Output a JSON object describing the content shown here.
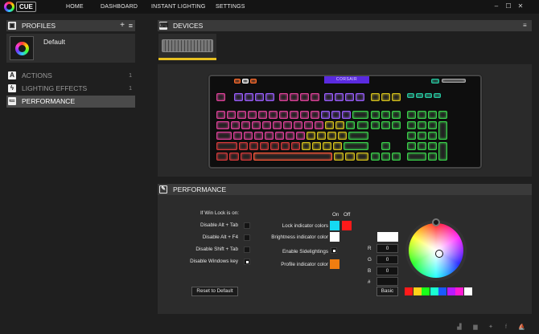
{
  "app": {
    "logo_text": "CUE"
  },
  "nav": [
    {
      "label": "HOME"
    },
    {
      "label": "DASHBOARD"
    },
    {
      "label": "INSTANT LIGHTING"
    },
    {
      "label": "SETTINGS"
    }
  ],
  "window": {
    "minimize": "–",
    "maximize": "☐",
    "close": "✕"
  },
  "profiles": {
    "title": "PROFILES",
    "add": "+",
    "menu": "≡",
    "items": [
      {
        "name": "Default"
      }
    ]
  },
  "sidebar": {
    "items": [
      {
        "icon": "A",
        "label": "ACTIONS",
        "count": "1"
      },
      {
        "icon": "ϟ",
        "label": "LIGHTING EFFECTS",
        "count": "1"
      },
      {
        "icon": "≔",
        "label": "PERFORMANCE",
        "count": ""
      }
    ]
  },
  "devices": {
    "title": "DEVICES",
    "menu": "≡",
    "logo_text": "CORSAIR"
  },
  "performance": {
    "title": "PERFORMANCE",
    "win_lock_title": "If Win Lock is on:",
    "options": [
      {
        "label": "Disable Alt + Tab",
        "checked": false
      },
      {
        "label": "Disable Alt + F4",
        "checked": false
      },
      {
        "label": "Disable Shift + Tab",
        "checked": false
      },
      {
        "label": "Disable Windows key",
        "checked": true
      }
    ],
    "on_label": "On",
    "off_label": "Off",
    "lock_label": "Lock indicator colors",
    "lock_on_color": "#15d9f2",
    "lock_off_color": "#ff1a1a",
    "brightness_label": "Brightness indicator color",
    "brightness_color": "#ffffff",
    "sidelight_label": "Enable Sidelightings",
    "sidelight_checked": true,
    "profile_label": "Profile indicator color",
    "profile_color": "#f07d10",
    "reset_label": "Reset to Default",
    "color_picker": {
      "preview_color": "#ffffff",
      "r_label": "R",
      "r": "0",
      "g_label": "G",
      "g": "0",
      "b_label": "B",
      "b": "0",
      "hex_label": "#",
      "hex": "",
      "basic_label": "Basic",
      "palette": [
        "#ff1a1a",
        "#ffd21a",
        "#1aff1a",
        "#1affd2",
        "#1a5aff",
        "#b81aff",
        "#ff1ad2",
        "#ffffff"
      ]
    }
  },
  "footer": {
    "icons": [
      "signal-icon",
      "chat-icon",
      "twitter-icon",
      "facebook-icon",
      "corsair-icon"
    ]
  }
}
